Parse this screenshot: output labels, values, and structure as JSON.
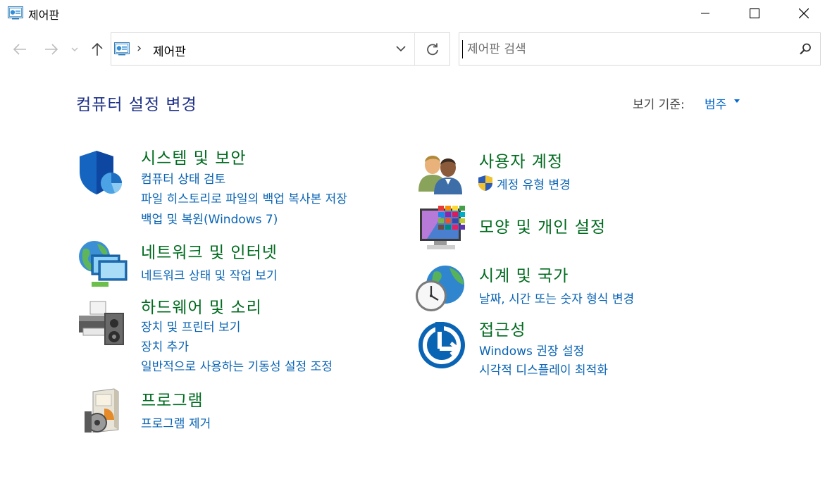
{
  "window": {
    "title": "제어판",
    "controls": [
      "minimize",
      "maximize",
      "close"
    ]
  },
  "nav": {
    "back_icon": "arrow-left-icon",
    "forward_icon": "arrow-right-icon",
    "recent_icon": "chevron-down-icon",
    "up_icon": "arrow-up-icon"
  },
  "address": {
    "separator": "›",
    "path": "제어판"
  },
  "search": {
    "placeholder": "제어판 검색",
    "value": ""
  },
  "main": {
    "title": "컴퓨터 설정 변경",
    "view_by_label": "보기 기준:",
    "view_by_value": "범주"
  },
  "categories": {
    "system_security": {
      "title": "시스템 및 보안",
      "links": [
        "컴퓨터 상태 검토",
        "파일 히스토리로 파일의 백업 복사본 저장",
        "백업 및 복원(Windows 7)"
      ]
    },
    "network": {
      "title": "네트워크 및 인터넷",
      "links": [
        "네트워크 상태 및 작업 보기"
      ]
    },
    "hardware": {
      "title": "하드웨어 및 소리",
      "links": [
        "장치 및 프린터 보기",
        "장치 추가",
        "일반적으로 사용하는 기동성 설정 조정"
      ]
    },
    "programs": {
      "title": "프로그램",
      "links": [
        "프로그램 제거"
      ]
    },
    "user_accounts": {
      "title": "사용자 계정",
      "links": [
        "계정 유형 변경"
      ]
    },
    "appearance": {
      "title": "모양 및 개인 설정",
      "links": []
    },
    "clock_region": {
      "title": "시계 및 국가",
      "links": [
        "날짜, 시간 또는 숫자 형식 변경"
      ]
    },
    "ease_of_access": {
      "title": "접근성",
      "links": [
        "Windows 권장 설정",
        "시각적 디스플레이 최적화"
      ]
    }
  },
  "colors": {
    "title_blue": "#1e3287",
    "category_green": "#006b1f",
    "link_blue": "#0a64b4"
  }
}
